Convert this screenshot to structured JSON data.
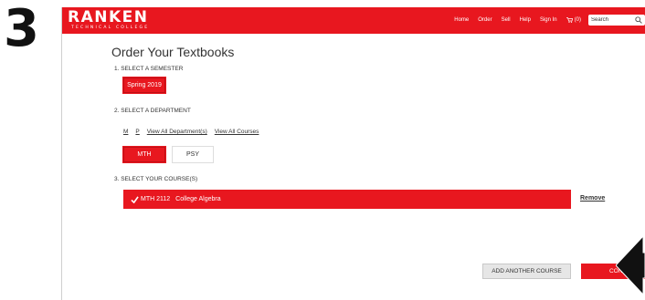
{
  "step": {
    "number": "3"
  },
  "header": {
    "logo_main": "RANKEN",
    "logo_sub": "TECHNICAL COLLEGE",
    "nav": [
      "Home",
      "Order",
      "Sell",
      "Help",
      "Sign In"
    ],
    "cart_count": "(0)",
    "cart_icon": "shopping-cart-icon",
    "search_placeholder": "Search",
    "search_icon": "search-icon"
  },
  "page": {
    "title": "Order Your Textbooks"
  },
  "semester": {
    "label": "1. SELECT A SEMESTER",
    "selected": "Spring 2019"
  },
  "department": {
    "label": "2. SELECT A DEPARTMENT",
    "letters": [
      "M",
      "P"
    ],
    "view_all_departments": "View All Department(s)",
    "view_all_courses": "View All Courses",
    "options": [
      {
        "code": "MTH",
        "selected": true
      },
      {
        "code": "PSY",
        "selected": false
      }
    ]
  },
  "courses": {
    "label": "3. SELECT YOUR COURSE(S)",
    "selected": [
      {
        "code": "MTH 2112",
        "name": "College Algebra",
        "icon": "checkmark-icon"
      }
    ],
    "remove_label": "Remove"
  },
  "actions": {
    "add_another": "ADD ANOTHER COURSE",
    "continue": "CONTINUE"
  },
  "colors": {
    "brand_red": "#e8171f",
    "text_dark": "#333333",
    "button_gray": "#e6e6e6"
  }
}
